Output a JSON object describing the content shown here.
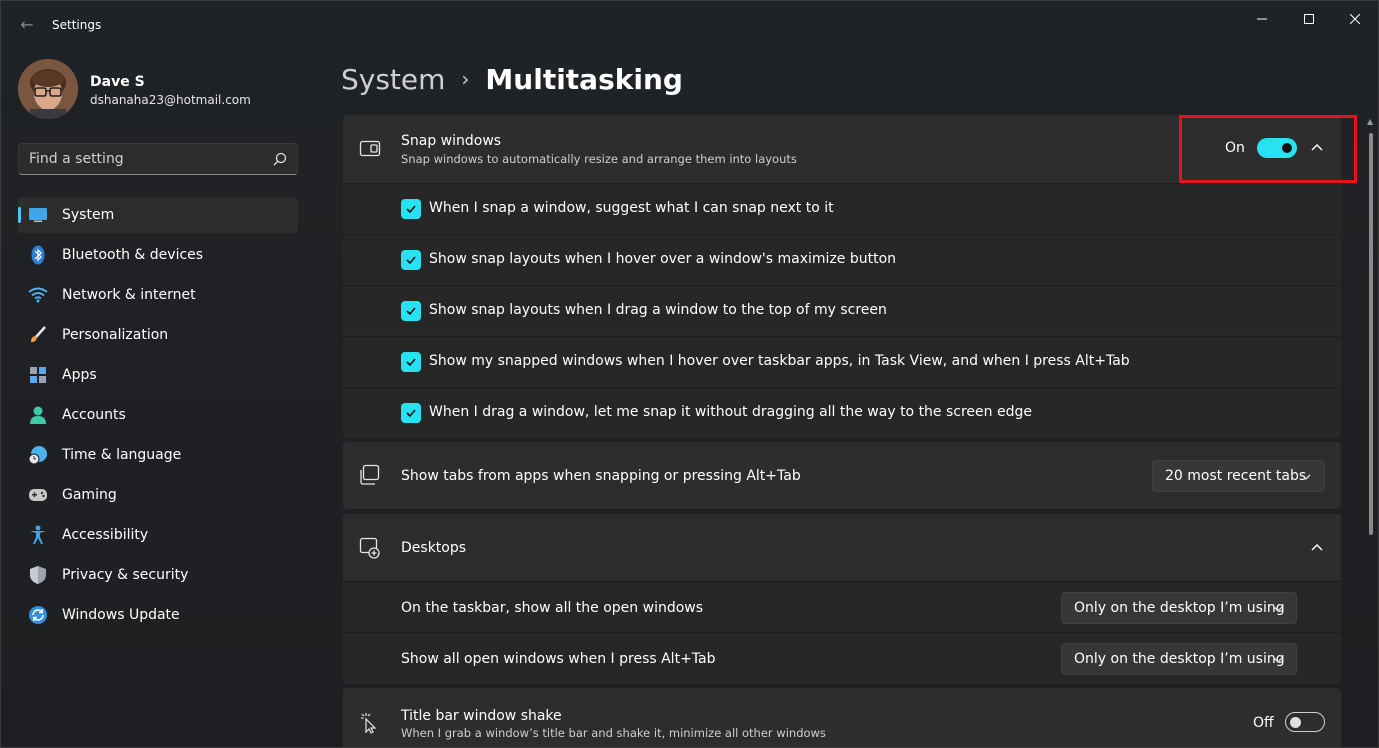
{
  "window": {
    "title": "Settings",
    "back_glyph": "←",
    "controls": [
      "minimize-icon",
      "maximize-icon",
      "close-icon"
    ]
  },
  "profile": {
    "name": "Dave S",
    "email": "dshanaha23@hotmail.com"
  },
  "search": {
    "placeholder": "Find a setting",
    "icon": "search-icon"
  },
  "sidebar": {
    "items": [
      {
        "label": "System",
        "icon": "system-monitor-icon",
        "active": true
      },
      {
        "label": "Bluetooth & devices",
        "icon": "bluetooth-icon"
      },
      {
        "label": "Network & internet",
        "icon": "wifi-icon"
      },
      {
        "label": "Personalization",
        "icon": "paintbrush-icon"
      },
      {
        "label": "Apps",
        "icon": "apps-icon"
      },
      {
        "label": "Accounts",
        "icon": "accounts-icon"
      },
      {
        "label": "Time & language",
        "icon": "time-language-icon"
      },
      {
        "label": "Gaming",
        "icon": "gamepad-icon"
      },
      {
        "label": "Accessibility",
        "icon": "accessibility-icon"
      },
      {
        "label": "Privacy & security",
        "icon": "shield-icon"
      },
      {
        "label": "Windows Update",
        "icon": "windows-update-icon"
      }
    ]
  },
  "breadcrumb": {
    "parent": "System",
    "separator": "›",
    "current": "Multitasking"
  },
  "snap": {
    "title": "Snap windows",
    "description": "Snap windows to automatically resize and arrange them into layouts",
    "toggle_label": "On",
    "toggle_on": true,
    "options": [
      {
        "label": "When I snap a window, suggest what I can snap next to it",
        "checked": true
      },
      {
        "label": "Show snap layouts when I hover over a window's maximize button",
        "checked": true
      },
      {
        "label": "Show snap layouts when I drag a window to the top of my screen",
        "checked": true
      },
      {
        "label": "Show my snapped windows when I hover over taskbar apps, in Task View, and when I press Alt+Tab",
        "checked": true
      },
      {
        "label": "When I drag a window, let me snap it without dragging all the way to the screen edge",
        "checked": true
      }
    ]
  },
  "tabs": {
    "title": "Show tabs from apps when snapping or pressing Alt+Tab",
    "selected": "20 most recent tabs"
  },
  "desktops": {
    "title": "Desktops",
    "rows": [
      {
        "label": "On the taskbar, show all the open windows",
        "selected": "Only on the desktop I’m using"
      },
      {
        "label": "Show all open windows when I press Alt+Tab",
        "selected": "Only on the desktop I’m using"
      }
    ]
  },
  "shake": {
    "title": "Title bar window shake",
    "description": "When I grab a window’s title bar and shake it, minimize all other windows",
    "toggle_label": "Off",
    "toggle_on": false
  },
  "colors": {
    "accent": "#27e2f0",
    "highlight": "#e8121f"
  }
}
